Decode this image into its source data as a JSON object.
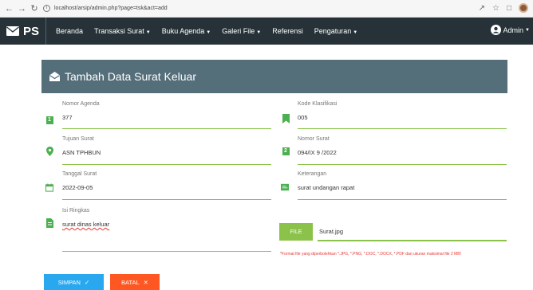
{
  "browser": {
    "url": "localhost/arsip/admin.php?page=tsk&act=add",
    "back_icon": "arrow-left-icon",
    "forward_icon": "arrow-right-icon",
    "reload_icon": "reload-icon",
    "info_icon": "info-icon"
  },
  "navbar": {
    "brand": "PS",
    "menu": [
      {
        "label": "Beranda",
        "dropdown": false
      },
      {
        "label": "Transaksi Surat",
        "dropdown": true
      },
      {
        "label": "Buku Agenda",
        "dropdown": true
      },
      {
        "label": "Galeri File",
        "dropdown": true
      },
      {
        "label": "Referensi",
        "dropdown": false
      },
      {
        "label": "Pengaturan",
        "dropdown": true
      }
    ],
    "user": "Admin",
    "background": "#263238"
  },
  "card": {
    "title": "Tambah Data Surat Keluar",
    "header_color": "#546e7a"
  },
  "form": {
    "left": [
      {
        "label": "Nomor Agenda",
        "value": "377",
        "icon": "number-one-icon",
        "icon_text": "1"
      },
      {
        "label": "Tujuan Surat",
        "value": "ASN TPHBUN",
        "icon": "location-pin-icon"
      },
      {
        "label": "Tanggal Surat",
        "value": "2022-09-05",
        "icon": "calendar-icon"
      },
      {
        "label": "Isi Ringkas",
        "value": "surat dinas keluar",
        "icon": "document-icon"
      }
    ],
    "right": [
      {
        "label": "Kode Klasifikasi",
        "value": "005",
        "icon": "bookmark-icon"
      },
      {
        "label": "Nomor Surat",
        "value": "094/IX 9 /2022",
        "icon": "number-two-icon",
        "icon_text": "2"
      },
      {
        "label": "Keterangan",
        "value": "surat undangan rapat",
        "icon": "notes-icon"
      }
    ],
    "file": {
      "button": "FILE",
      "value": "Surat.jpg",
      "note": "*Format file yang diperbolehkan *.JPG, *.PNG, *.DOC, *.DOCX, *.PDF dan ukuran maksimal file 2 MB!"
    }
  },
  "actions": {
    "save": "SIMPAN",
    "cancel": "BATAL"
  },
  "colors": {
    "accent_green": "#8bc34a",
    "icon_green": "#4caf50",
    "save_blue": "#29a8f0",
    "cancel_orange": "#ff5722",
    "note_red": "#e53935"
  }
}
